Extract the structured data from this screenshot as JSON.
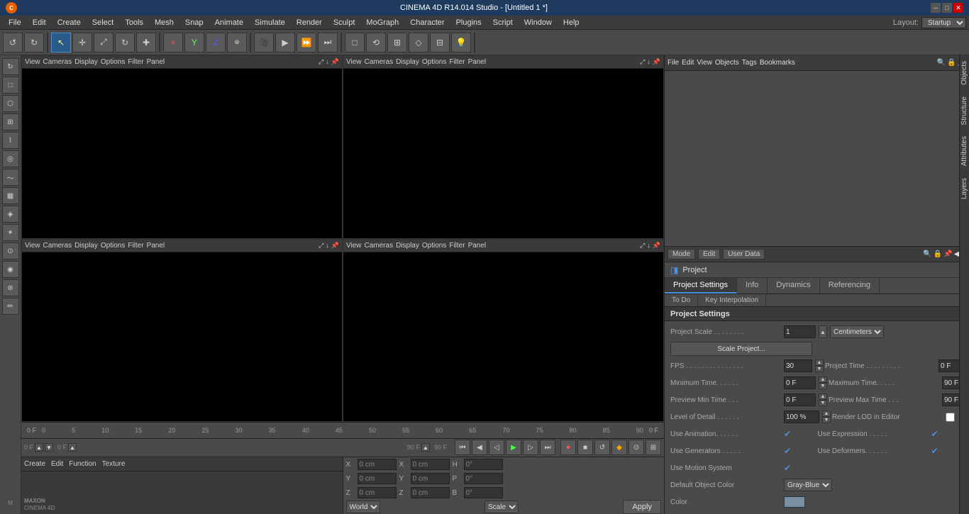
{
  "titleBar": {
    "title": "CINEMA 4D R14.014 Studio - [Untitled 1 *]",
    "minimizeLabel": "─",
    "maximizeLabel": "□",
    "closeLabel": "✕"
  },
  "menuBar": {
    "items": [
      "File",
      "Edit",
      "Create",
      "Select",
      "Tools",
      "Mesh",
      "Snap",
      "Animate",
      "Simulate",
      "Render",
      "Sculpt",
      "MoGraph",
      "Character",
      "Plugins",
      "Script",
      "Window",
      "Help"
    ],
    "layoutLabel": "Layout:",
    "layoutValue": "Startup"
  },
  "viewports": {
    "topLeft": {
      "menus": [
        "View",
        "Cameras",
        "Display",
        "Options",
        "Filter",
        "Panel"
      ]
    },
    "topRight": {
      "menus": [
        "View",
        "Cameras",
        "Display",
        "Options",
        "Filter",
        "Panel"
      ]
    },
    "bottomLeft": {
      "menus": [
        "View",
        "Cameras",
        "Display",
        "Options",
        "Filter",
        "Panel"
      ]
    },
    "bottomRight": {
      "menus": [
        "View",
        "Cameras",
        "Display",
        "Options",
        "Filter",
        "Panel"
      ]
    }
  },
  "timeline": {
    "startFrame": "0 F",
    "endFrame": "90 F",
    "currentFrame": "0 F",
    "ticks": [
      "0",
      "5",
      "10",
      "15",
      "20",
      "25",
      "30",
      "35",
      "40",
      "45",
      "50",
      "55",
      "60",
      "65",
      "70",
      "75",
      "80",
      "85",
      "90"
    ],
    "endLabel": "0 F",
    "controls": {
      "currentTime": "0 F",
      "minTime": "0 F",
      "maxTime": "90 F",
      "step": "90 F"
    }
  },
  "coordBar": {
    "x1Label": "X",
    "x1Value": "0 cm",
    "y1Label": "Y",
    "y1Value": "0 cm",
    "z1Label": "Z",
    "z1Value": "0 cm",
    "x2Label": "X",
    "x2Value": "0 cm",
    "y2Label": "Y",
    "y2Value": "0 cm",
    "z2Label": "Z",
    "z2Value": "0 cm",
    "hLabel": "H",
    "hValue": "0°",
    "pLabel": "P",
    "pValue": "0°",
    "bLabel": "B",
    "bValue": "0°",
    "worldLabel": "World",
    "scaleLabel": "Scale",
    "applyLabel": "Apply"
  },
  "objectManager": {
    "menuItems": [
      "File",
      "Edit",
      "View",
      "Objects",
      "Tags",
      "Bookmarks"
    ]
  },
  "attributeManager": {
    "menuItems": [
      "Mode",
      "Edit",
      "User Data"
    ],
    "projectLabel": "Project",
    "tabs": [
      "Project Settings",
      "Info",
      "Dynamics",
      "Referencing"
    ],
    "tabs2": [
      "To Do",
      "Key Interpolation"
    ],
    "sectionTitle": "Project Settings",
    "fps": {
      "label": "FPS . . . . . . . . . . . . . . .",
      "value": "30"
    },
    "projectTime": {
      "label": "Project Time . . . . . . . . .",
      "value": "0 F"
    },
    "minTime": {
      "label": "Minimum Time. . . . . .",
      "value": "0 F"
    },
    "maxTime": {
      "label": "Maximum Time. . . . .",
      "value": "90 F"
    },
    "previewMinTime": {
      "label": "Preview Min Time . . .",
      "value": "0 F"
    },
    "previewMaxTime": {
      "label": "Preview Max Time . . .",
      "value": "90 F"
    },
    "levelOfDetail": {
      "label": "Level of Detail . . . . . .",
      "value": "100 %"
    },
    "renderLOD": {
      "label": "Render LOD in Editor"
    },
    "projectScale": {
      "label": "Project Scale . . . . . . . .",
      "value": "1",
      "unit": "Centimeters"
    },
    "scaleProjectBtn": "Scale Project...",
    "useAnimation": {
      "label": "Use Animation. . . . . .",
      "checked": true
    },
    "useExpression": {
      "label": "Use Expression . . . . .",
      "checked": true
    },
    "useGenerators": {
      "label": "Use Generators . . . . .",
      "checked": true
    },
    "useDeformers": {
      "label": "Use Deformers. . . . . .",
      "checked": true
    },
    "useMotionSystem": {
      "label": "Use Motion System",
      "checked": true
    },
    "defaultObjectColor": {
      "label": "Default Object Color",
      "value": "Gray-Blue"
    },
    "color": {
      "label": "Color"
    }
  },
  "sideTabs": {
    "objects": "Objects",
    "structure": "Structure",
    "attributes": "Attributes",
    "layers": "Layers"
  },
  "bottomTabs": {
    "left": {
      "menus": [
        "Create",
        "Edit",
        "Function",
        "Texture"
      ]
    }
  },
  "icons": {
    "undo": "↺",
    "redo": "↻",
    "move": "✛",
    "rotate": "↻",
    "scale": "⤢",
    "x": "×",
    "y": "Y",
    "z": "Z",
    "play": "▶",
    "pause": "⏸",
    "rewind": "⏮",
    "forward": "⏭",
    "frameBack": "◀",
    "frameForward": "▶"
  }
}
